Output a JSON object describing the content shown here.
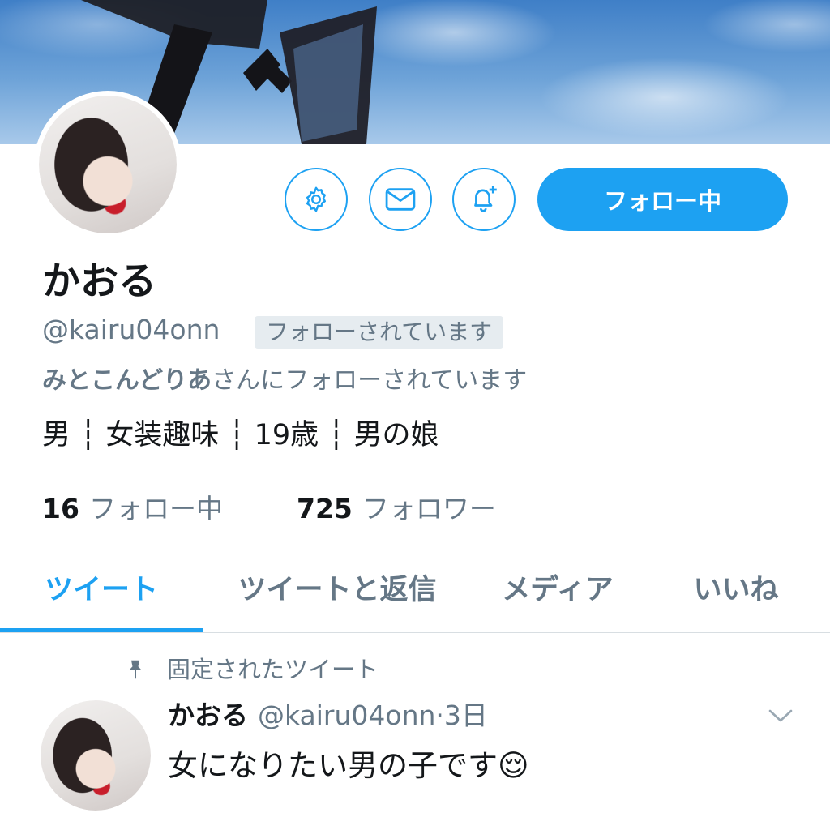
{
  "profile": {
    "display_name": "かおる",
    "handle": "@kairu04onn",
    "follows_you_badge": "フォローされています",
    "mutual_name": "みとこんどりあ",
    "mutual_suffix": "さんにフォローされています",
    "bio": "男 ┆ 女装趣味 ┆ 19歳 ┆ 男の娘"
  },
  "actions": {
    "settings_icon": "gear-icon",
    "dm_icon": "envelope-icon",
    "notify_icon": "bell-plus-icon",
    "follow_button_label": "フォロー中"
  },
  "stats": {
    "following_count": "16",
    "following_label": "フォロー中",
    "followers_count": "725",
    "followers_label": "フォロワー"
  },
  "tabs": [
    {
      "label": "ツイート",
      "active": true
    },
    {
      "label": "ツイートと返信",
      "active": false
    },
    {
      "label": "メディア",
      "active": false
    },
    {
      "label": "いいね",
      "active": false
    }
  ],
  "pinned_tweet": {
    "pinned_label": "固定されたツイート",
    "author_name": "かおる",
    "author_handle": "@kairu04onn",
    "time": "·3日",
    "text": "女になりたい男の子です😌"
  },
  "colors": {
    "accent": "#1da1f2",
    "secondary_text": "#657786",
    "primary_text": "#14171a",
    "badge_bg": "#e6ecf0"
  }
}
